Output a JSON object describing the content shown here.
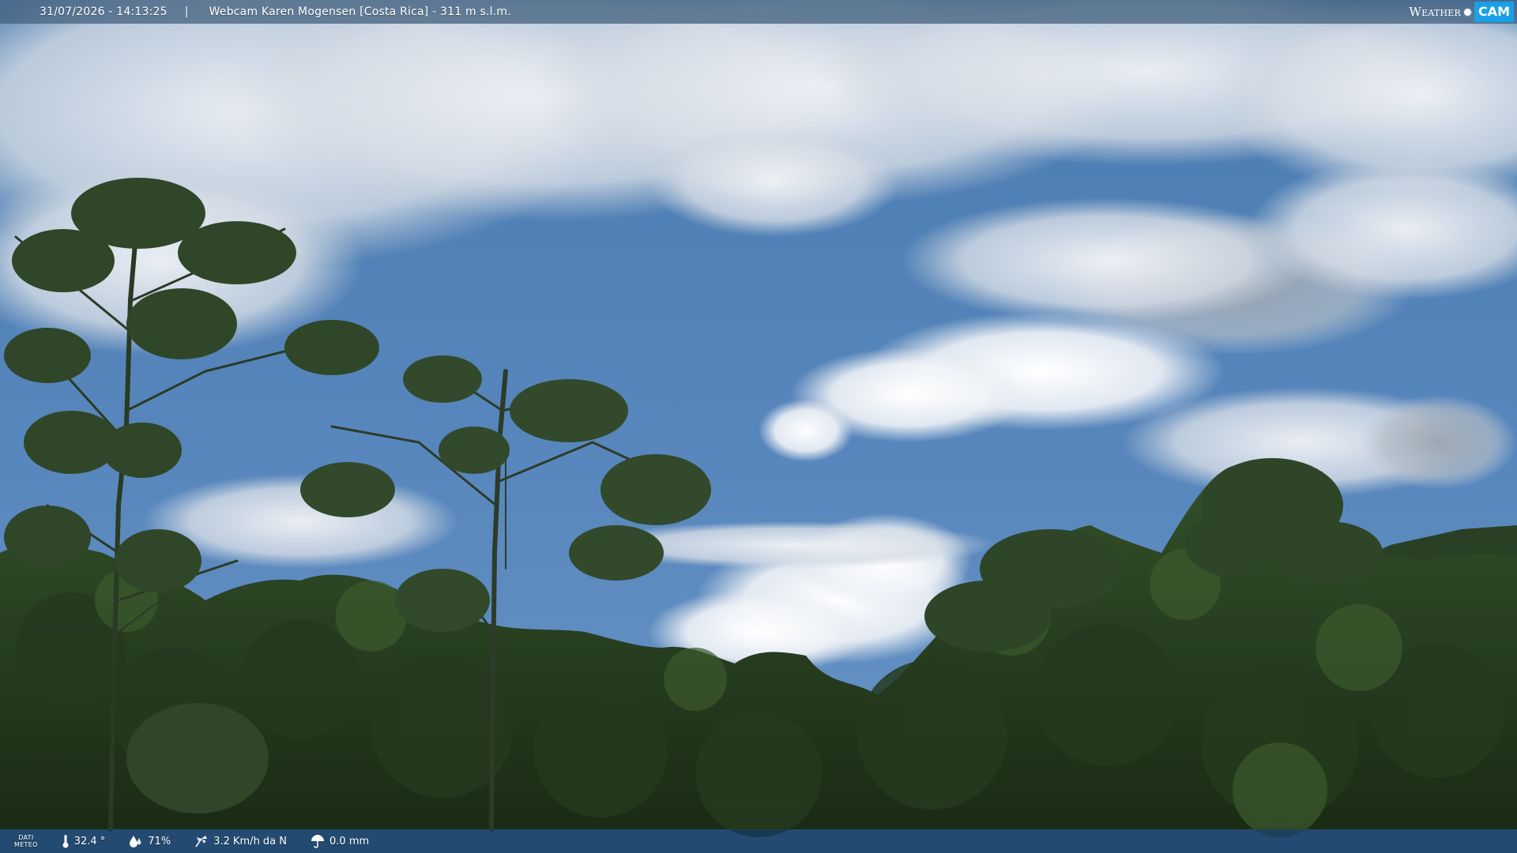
{
  "overlay": {
    "datetime": "31/07/2026 - 14:13:25",
    "separator": "|",
    "camera_title": "Webcam Karen Mogensen [Costa Rica] - 311 m s.l.m.",
    "logo": {
      "weather_text": "Weather",
      "cam_text": "CAM",
      "accent_color": "#1aa0e6"
    }
  },
  "weather": {
    "label_line1": "DATI",
    "label_line2": "METEO",
    "temperature": "32.4 °",
    "humidity": "71%",
    "wind": "3.2 Km/h da N",
    "rain": "0.0 mm",
    "icons": [
      "thermometer-icon",
      "humidity-icon",
      "wind-icon",
      "rain-icon"
    ]
  },
  "colors": {
    "sky_top": "#4f7fb3",
    "sky_bottom": "#5e8fc4",
    "forest_dark": "#1c2e17",
    "forest_mid": "#2f4a24",
    "top_bar": "#46647f",
    "bottom_bar": "#12375a"
  }
}
